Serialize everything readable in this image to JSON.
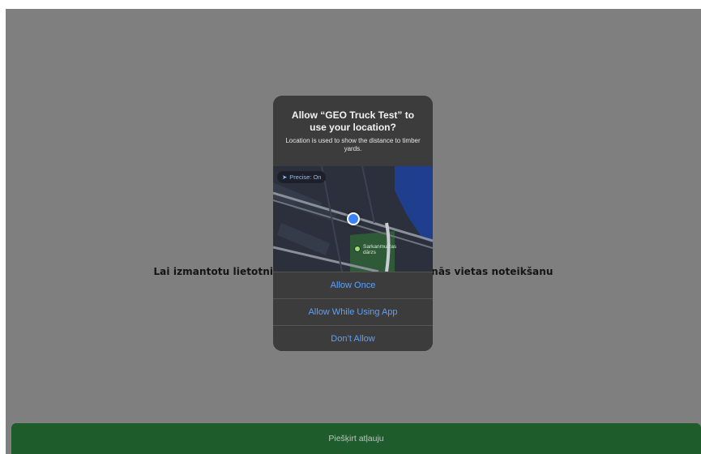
{
  "background_text": "Lai izmantotu lietotni, nepieciešams atļaut atrašanās vietas noteikšanu",
  "grant_button": "Piešķirt atļauju",
  "alert": {
    "title": "Allow “GEO Truck Test” to use your location?",
    "message": "Location is used to show the distance to timber yards.",
    "precise_label": "Precise: On",
    "map_poi": "Sarkanmuižas dārzs",
    "buttons": [
      "Allow Once",
      "Allow While Using App",
      "Don’t Allow"
    ]
  },
  "colors": {
    "accent": "#1f5c2c",
    "link": "#5aa0ff",
    "dialog": "#3c3c3c"
  }
}
